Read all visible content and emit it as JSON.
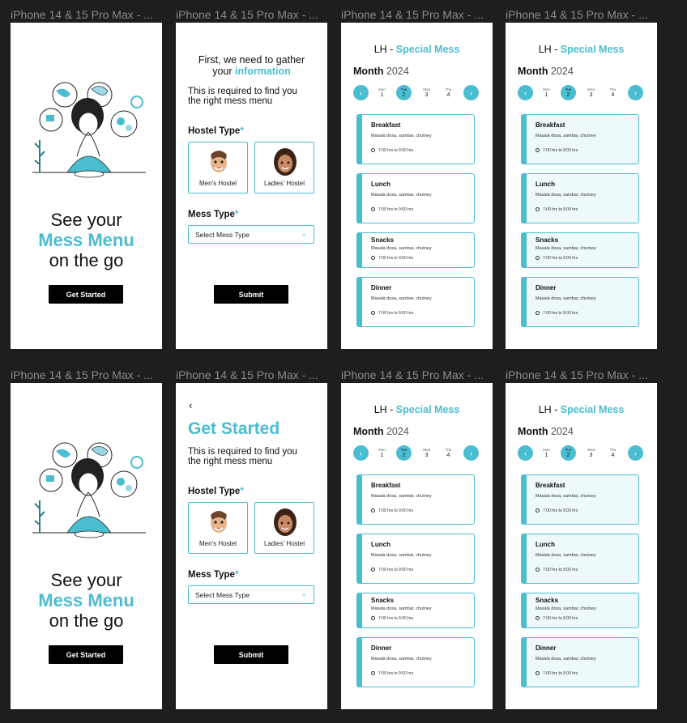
{
  "frame_label": "iPhone 14 & 15 Pro Max - ...",
  "landing": {
    "line1": "See your",
    "line2": "Mess Menu",
    "line3": "on the go",
    "button": "Get Started"
  },
  "form_a": {
    "title_line1": "First, we need to gather",
    "title_line2_prefix": "your ",
    "title_line2_highlight": "information"
  },
  "form_b": {
    "back": "‹",
    "title": "Get Started"
  },
  "form": {
    "subtitle_line1": "This is required to find you",
    "subtitle_line2": "the right mess menu",
    "hostel_label": "Hostel Type",
    "mess_label": "Mess Type",
    "required_mark": "*",
    "mens": "Men's Hostel",
    "ladies": "Ladies' Hostel",
    "select_placeholder": "Select Mess Type",
    "submit": "Submit"
  },
  "menu": {
    "prefix": "LH - ",
    "special": "Special Mess",
    "month": "Month",
    "year": "2024",
    "days": [
      {
        "name": "Mon",
        "num": "1"
      },
      {
        "name": "Tue",
        "num": "2"
      },
      {
        "name": "Wed",
        "num": "3"
      },
      {
        "name": "Thu",
        "num": "4"
      }
    ],
    "meals": [
      {
        "name": "Breakfast",
        "desc": "Masala dosa, sambar, chutney",
        "time": "7:00 hrs to 9:00 hrs"
      },
      {
        "name": "Lunch",
        "desc": "Masala dosa, sambar, chutney",
        "time": "7:00 hrs to 9:00 hrs"
      },
      {
        "name": "Snacks",
        "desc": "Masala dosa, sambar, chutney",
        "time": "7:00 hrs to 9:00 hrs"
      },
      {
        "name": "Dinner",
        "desc": "Masala dosa, sambar, chutney",
        "time": "7:00 hrs to 9:00 hrs"
      }
    ]
  },
  "colors": {
    "accent": "#4bbdd1",
    "canvas": "#1e1e1e",
    "button": "#000000"
  },
  "icons": [
    "chevron-left-icon",
    "chevron-right-icon",
    "chevron-down-icon",
    "clock-icon",
    "back-arrow-icon"
  ]
}
